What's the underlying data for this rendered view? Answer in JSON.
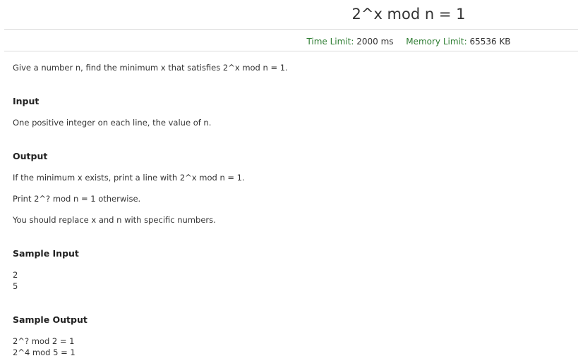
{
  "problem": {
    "title": "2^x mod n = 1",
    "time_limit_label": "Time Limit:",
    "time_limit_value": "2000 ms",
    "memory_limit_label": "Memory Limit:",
    "memory_limit_value": "65536 KB",
    "description": "Give a number n, find the minimum x that satisfies 2^x mod n = 1.",
    "input_title": "Input",
    "input_text": "One positive integer on each line, the value of n.",
    "output_title": "Output",
    "output_lines": [
      "If the minimum x exists, print a line with 2^x mod n = 1.",
      "Print 2^? mod n = 1 otherwise.",
      "You should replace x and n with specific numbers."
    ],
    "sample_input_title": "Sample Input",
    "sample_input_lines": [
      "2",
      "5"
    ],
    "sample_output_title": "Sample Output",
    "sample_output_lines": [
      "2^? mod 2 = 1",
      "2^4 mod 5 = 1"
    ]
  }
}
